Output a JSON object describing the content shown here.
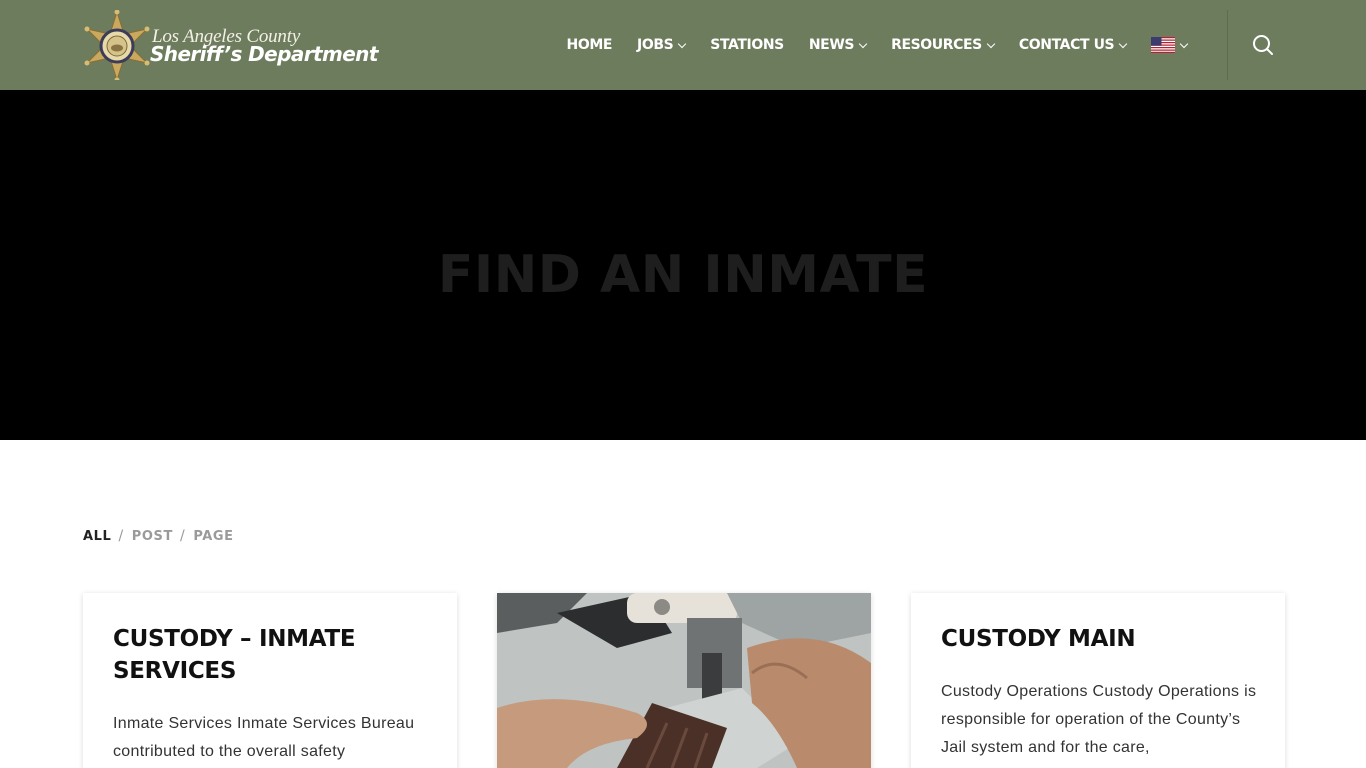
{
  "logo": {
    "line1": "Los Angeles County",
    "line2": "Sheriff’s Department"
  },
  "nav": {
    "items": [
      {
        "label": "HOME",
        "dropdown": false
      },
      {
        "label": "JOBS",
        "dropdown": true
      },
      {
        "label": "STATIONS",
        "dropdown": false
      },
      {
        "label": "NEWS",
        "dropdown": true
      },
      {
        "label": "RESOURCES",
        "dropdown": true
      },
      {
        "label": "CONTACT US",
        "dropdown": true
      }
    ],
    "language_icon": "us-flag-icon",
    "search_icon": "search-icon"
  },
  "hero": {
    "title": "FIND AN INMATE"
  },
  "filters": {
    "items": [
      "ALL",
      "POST",
      "PAGE"
    ],
    "active": "ALL"
  },
  "cards": [
    {
      "title": "CUSTODY – INMATE SERVICES",
      "excerpt": "Inmate Services Inmate Services Bureau contributed to the overall safety"
    },
    {
      "image": "sewing-machine-photo"
    },
    {
      "title": "CUSTODY MAIN",
      "excerpt": "Custody Operations Custody Operations is responsible for operation of the County’s Jail system and for the care,"
    }
  ],
  "colors": {
    "header_bg": "#6e7c5e",
    "hero_bg": "#000000",
    "hero_title": "#1e1e1e",
    "filter_active": "#222222",
    "filter_inactive": "#9a9a9a"
  }
}
